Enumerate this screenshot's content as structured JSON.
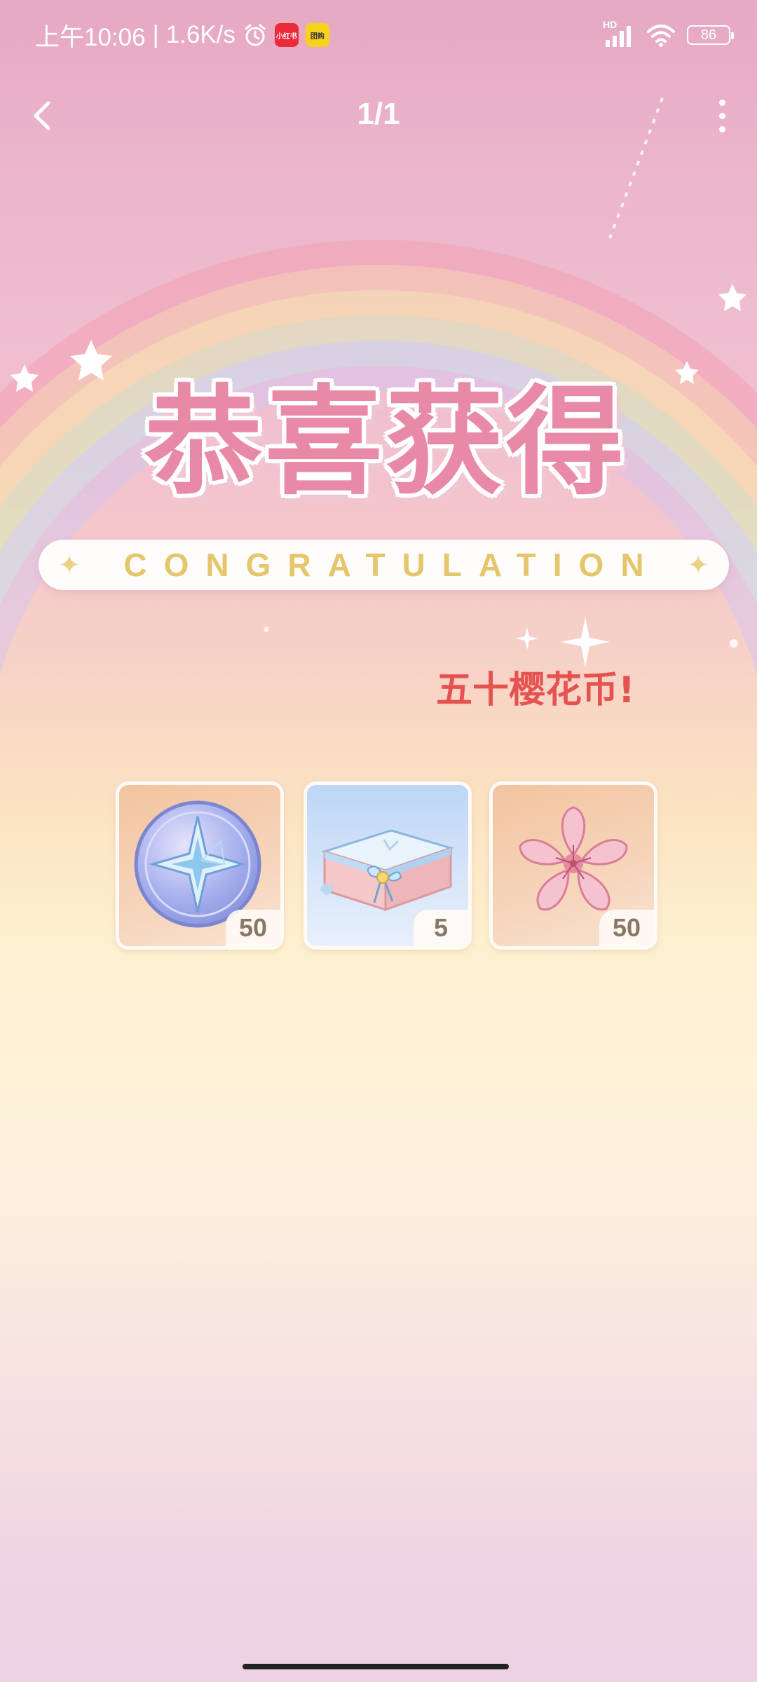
{
  "status_bar": {
    "time": "上午10:06",
    "separator": "|",
    "net_speed": "1.6K/s",
    "alarm_icon": "alarm-icon",
    "app_badges": [
      {
        "name": "xiaohongshu-badge-icon",
        "label": "小红书",
        "color": "#ec2a3a"
      },
      {
        "name": "meituan-badge-icon",
        "label": "团购",
        "color": "#f7d21b"
      }
    ],
    "network_type": "HD",
    "battery": "86"
  },
  "nav": {
    "page_indicator": "1/1",
    "back_icon": "chevron-left-icon",
    "more_icon": "more-vertical-icon"
  },
  "banner": {
    "title": "恭喜获得",
    "subtitle": "CONGRATULATION",
    "title_color": "#e88aa7",
    "subtitle_color": "#e5c66c"
  },
  "reward_text": "五十樱花币!",
  "rewards": [
    {
      "icon": "star-coin-icon",
      "count": "50"
    },
    {
      "icon": "gift-box-icon",
      "count": "5"
    },
    {
      "icon": "sakura-flower-icon",
      "count": "50"
    }
  ],
  "colors": {
    "reward_text": "#e5524f",
    "background_top": "#e6a8c2",
    "background_middle": "#fdf0cf"
  }
}
